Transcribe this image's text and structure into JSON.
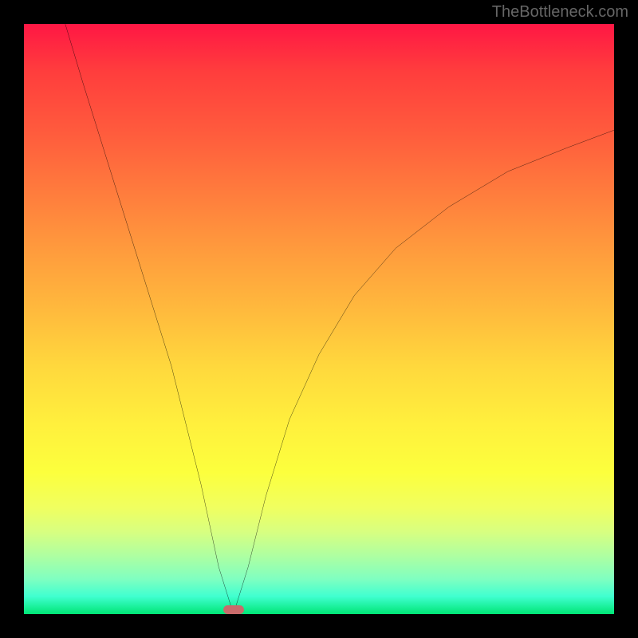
{
  "watermark": "TheBottleneck.com",
  "chart_data": {
    "type": "line",
    "title": "",
    "xlabel": "",
    "ylabel": "",
    "xlim": [
      0,
      100
    ],
    "ylim": [
      0,
      100
    ],
    "background": "rainbow-gradient-vertical",
    "background_colors": {
      "top": "#ff1744",
      "middle": "#ffd83d",
      "bottom": "#00e676"
    },
    "curve": {
      "description": "V-shaped curve: steep near-linear descent on left from top to valley, then curved ascent on right approaching ~80% height at right edge",
      "minimum_x": 35.5,
      "minimum_y": 0,
      "points": [
        {
          "x": 7,
          "y": 100
        },
        {
          "x": 10,
          "y": 90
        },
        {
          "x": 15,
          "y": 74
        },
        {
          "x": 20,
          "y": 58
        },
        {
          "x": 25,
          "y": 42
        },
        {
          "x": 30,
          "y": 22
        },
        {
          "x": 33,
          "y": 8
        },
        {
          "x": 35.5,
          "y": 0
        },
        {
          "x": 38,
          "y": 8
        },
        {
          "x": 41,
          "y": 20
        },
        {
          "x": 45,
          "y": 33
        },
        {
          "x": 50,
          "y": 44
        },
        {
          "x": 56,
          "y": 54
        },
        {
          "x": 63,
          "y": 62
        },
        {
          "x": 72,
          "y": 69
        },
        {
          "x": 82,
          "y": 75
        },
        {
          "x": 92,
          "y": 79
        },
        {
          "x": 100,
          "y": 82
        }
      ]
    },
    "marker": {
      "x": 35.5,
      "y": 0,
      "width_pct": 3.5,
      "height_pct": 1.5,
      "color": "#c96b6b"
    }
  }
}
